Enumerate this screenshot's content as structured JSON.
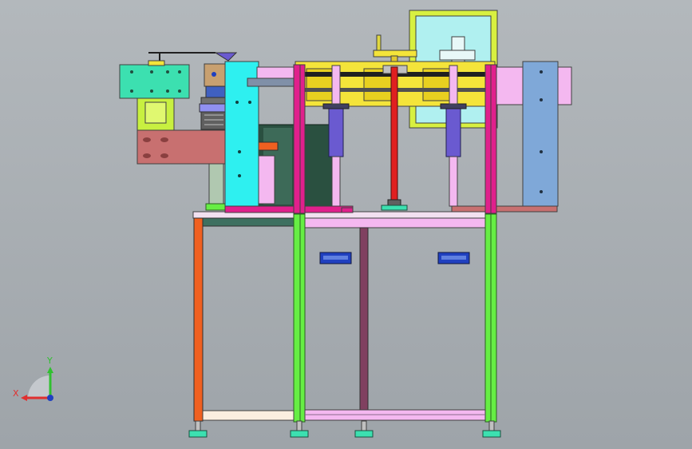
{
  "viewport": {
    "background_top": "#b3b8bc",
    "background_bottom": "#9ea4a9"
  },
  "triad": {
    "x_label": "X",
    "y_label": "Y",
    "x_color": "#e03030",
    "y_color": "#30c030",
    "z_color": "#2040c0"
  },
  "colors": {
    "frame_green": "#66ee44",
    "frame_magenta": "#e0208c",
    "rail_yellow": "#f4e43a",
    "cyan": "#2ef0f0",
    "pink": "#f4b8f0",
    "teal": "#3ce0b0",
    "steel_blue": "#7fa8d8",
    "salmon": "#c87070",
    "orange": "#f06020",
    "violet": "#6a5ad0",
    "lime": "#c8f040",
    "dark_green": "#2a5040",
    "navy": "#2040c0",
    "red_rod": "#e02020",
    "purple_post": "#804060"
  }
}
